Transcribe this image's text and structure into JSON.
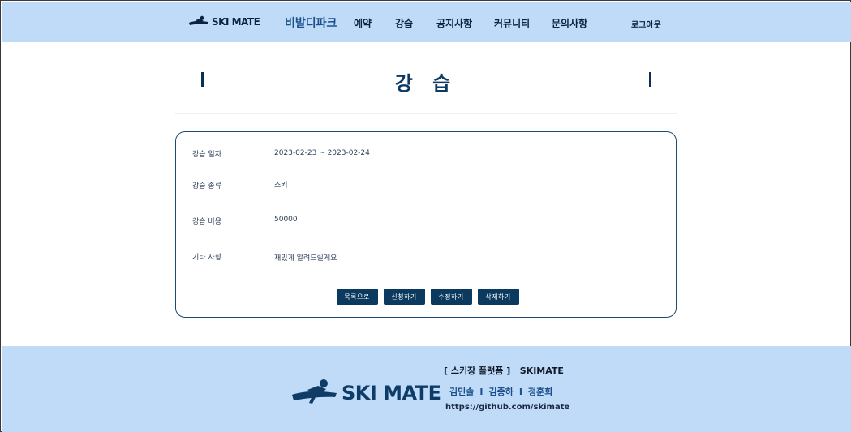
{
  "header": {
    "logo_text": "SKI MATE",
    "nav": {
      "brand": "비발디파크",
      "reserve": "예약",
      "lesson": "강습",
      "notice": "공지사항",
      "community": "커뮤니티",
      "inquiry": "문의사항",
      "logout": "로그아웃"
    }
  },
  "page": {
    "title": "강 습"
  },
  "details": {
    "rows": [
      {
        "label": "강습 일자",
        "value": "2023-02-23 ~ 2023-02-24"
      },
      {
        "label": "강습 종류",
        "value": "스키"
      },
      {
        "label": "강습 비용",
        "value": "50000"
      },
      {
        "label": "기타 사항",
        "value": "재밌게 알려드릴게요"
      }
    ],
    "buttons": {
      "list": "목록으로",
      "apply": "신청하기",
      "edit": "수정하기",
      "delete": "삭제하기"
    }
  },
  "footer": {
    "logo_text": "SKI MATE",
    "platform": "[ 스키장 플랫폼 ]   SKIMATE",
    "members": [
      "김민솔",
      "김종하",
      "정훈희"
    ],
    "member_separator": "I",
    "link": "https://github.com/skimate"
  },
  "colors": {
    "header_bg": "#bfdbf7",
    "footer_bg": "#bfdbf7",
    "primary": "#0c3a5e",
    "title": "#0c3a64"
  }
}
